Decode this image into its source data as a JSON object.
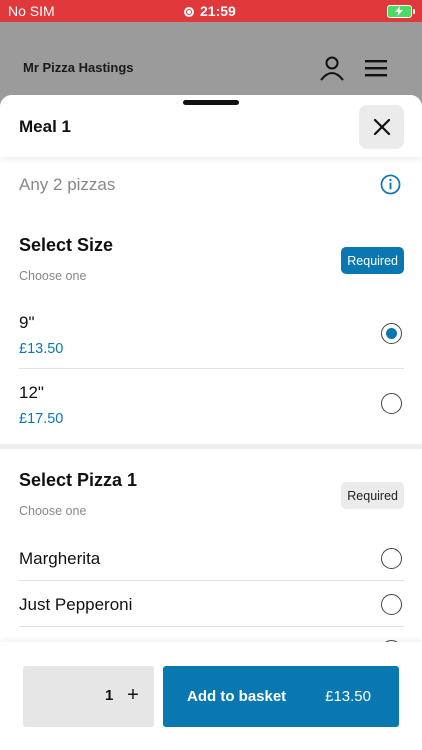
{
  "status": {
    "carrier": "No SIM",
    "time": "21:59"
  },
  "header": {
    "shop_name": "Mr Pizza Hastings",
    "user_icon": "user-icon",
    "menu_icon": "hamburger-menu-icon"
  },
  "sheet": {
    "title": "Meal 1",
    "description": "Any 2 pizzas"
  },
  "size_section": {
    "title": "Select Size",
    "subtitle": "Choose one",
    "badge": "Required",
    "options": [
      {
        "name": "9\"",
        "price": "£13.50",
        "selected": true
      },
      {
        "name": "12\"",
        "price": "£17.50",
        "selected": false
      }
    ]
  },
  "pizza_section": {
    "title": "Select Pizza 1",
    "subtitle": "Choose one",
    "badge": "Required",
    "options": [
      {
        "name": "Margherita",
        "selected": false
      },
      {
        "name": "Just Pepperoni",
        "selected": false
      }
    ]
  },
  "footer": {
    "quantity": "1",
    "plus": "+",
    "add_label": "Add to basket",
    "add_price": "£13.50"
  },
  "colors": {
    "accent": "#0a78b0",
    "status_bar": "#e0383b",
    "backdrop": "#9b9b9b"
  }
}
